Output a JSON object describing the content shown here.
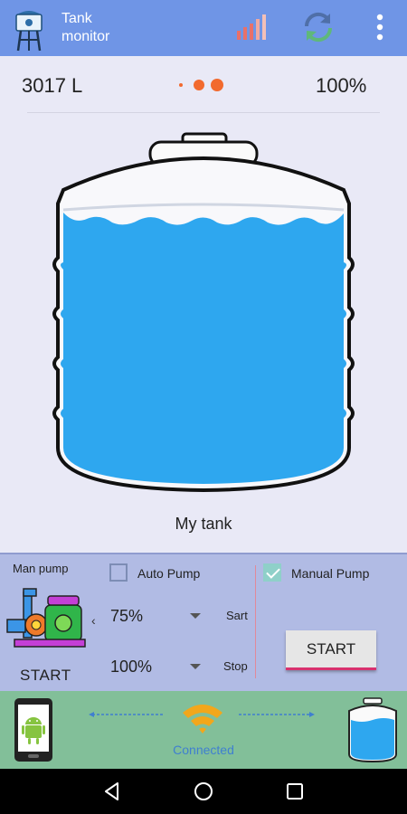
{
  "app": {
    "title_line1": "Tank",
    "title_line2": "monitor",
    "icons": {
      "logo": "water-tower-icon",
      "signal": "signal-bars-icon",
      "refresh": "refresh-icon",
      "menu": "more-vert-icon"
    }
  },
  "status": {
    "volume": "3017 L",
    "percent": "100%",
    "page_indicator_dots": 3,
    "active_dot_index": 2
  },
  "tank": {
    "name": "My tank",
    "fill_level": 1.0,
    "water_color": "#2ea7ef"
  },
  "panel": {
    "man_pump_label": "Man pump",
    "pump_state": "START",
    "auto_pump": {
      "label": "Auto Pump",
      "checked": false
    },
    "manual_pump": {
      "label": "Manual Pump",
      "checked": true
    },
    "start_level": {
      "value": "75%",
      "label": "Sart"
    },
    "stop_level": {
      "value": "100%",
      "label": "Stop"
    },
    "start_button": "START"
  },
  "connection": {
    "status": "Connected",
    "icons": {
      "device": "android-phone-icon",
      "wifi": "wifi-icon",
      "tank": "tank-icon"
    }
  },
  "colors": {
    "appbar": "#6f95e6",
    "panel": "#b1bbe4",
    "connection_bar": "#82bf99",
    "accent_dot": "#f26a2e",
    "button_underline": "#d8316e"
  }
}
